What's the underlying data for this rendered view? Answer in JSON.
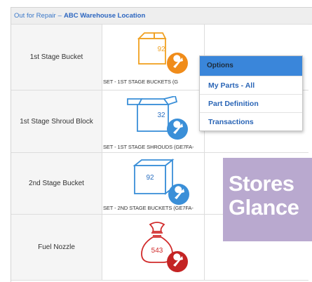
{
  "header": {
    "status": "Out for Repair",
    "separator": "–",
    "location": "ABC Warehouse Location"
  },
  "rows": [
    {
      "label": "1st Stage Bucket",
      "count": "92",
      "set_label": "SET - 1ST STAGE BUCKETS (G",
      "icon": "box-open-icon",
      "color": "#f0a020"
    },
    {
      "label": "1st Stage Shroud Block",
      "count": "32",
      "set_label": "SET - 1ST STAGE SHROUDS (GE7FA-",
      "icon": "box-open-icon",
      "color": "#3a8fd8"
    },
    {
      "label": "2nd Stage Bucket",
      "count": "92",
      "set_label": "SET - 2ND STAGE BUCKETS (GE7FA-",
      "icon": "box-icon",
      "color": "#3a8fd8"
    },
    {
      "label": "Fuel Nozzle",
      "count": "543",
      "set_label": "",
      "icon": "bag-icon",
      "color": "#d12b2b"
    }
  ],
  "menu": {
    "title": "Options",
    "items": [
      "My Parts - All",
      "Part Definition",
      "Transactions"
    ]
  },
  "banner": {
    "line1": "Stores",
    "line2": "Glance"
  },
  "colors": {
    "accent_blue": "#3a86da",
    "orange": "#f0a020",
    "red": "#d12b2b",
    "banner_purple": "#b9a9cf"
  }
}
